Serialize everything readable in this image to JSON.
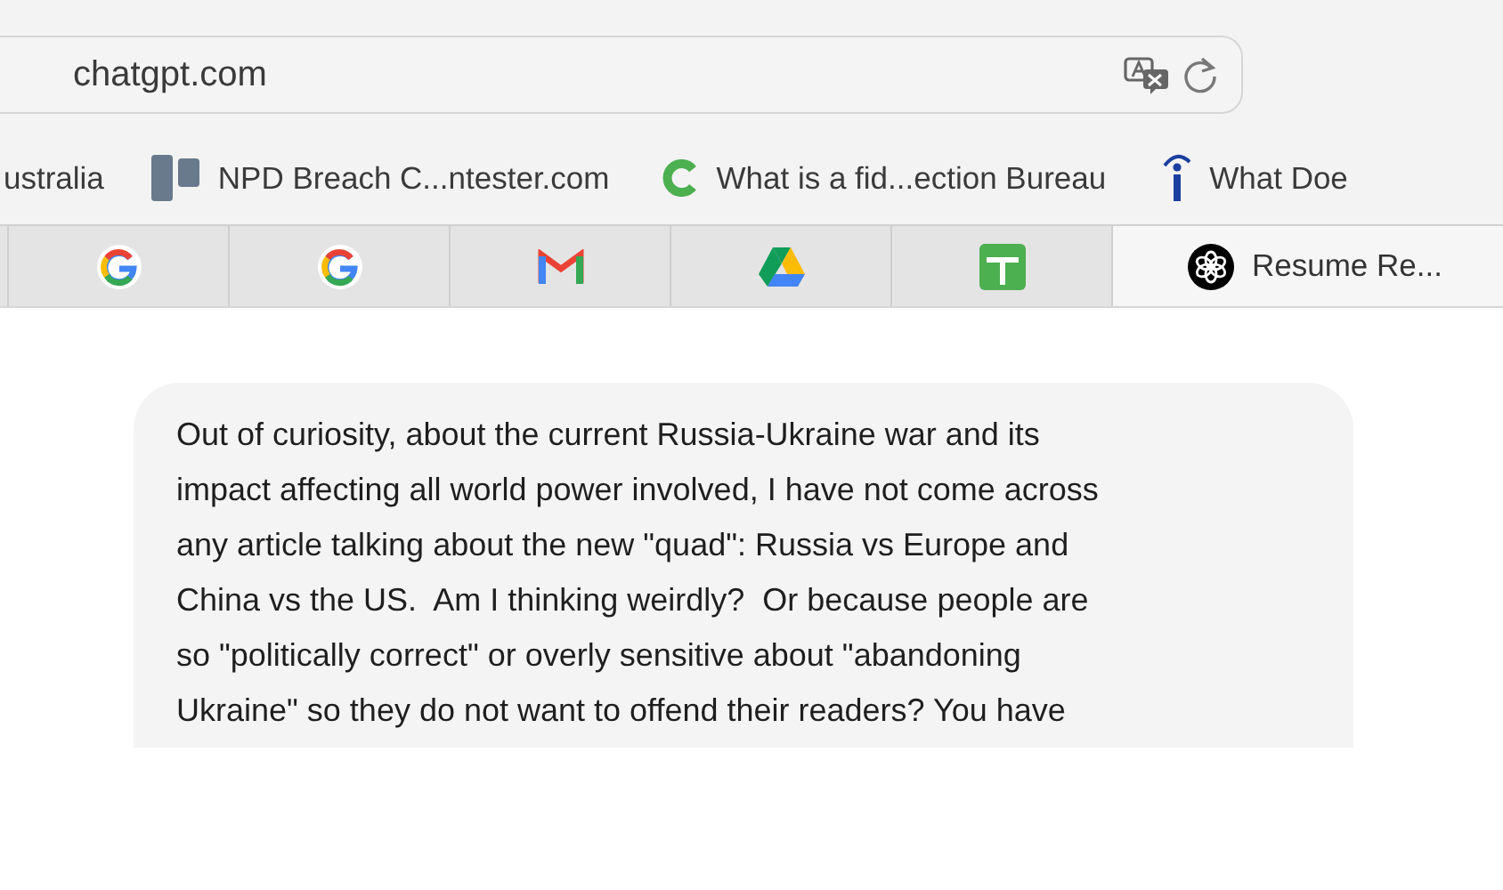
{
  "address_bar": {
    "url": "chatgpt.com"
  },
  "bookmarks": [
    {
      "label": "ustralia"
    },
    {
      "label": "NPD Breach C...ntester.com"
    },
    {
      "label": "What is a fid...ection Bureau"
    },
    {
      "label": "What Doe"
    }
  ],
  "tabs": [
    {
      "selected": false
    },
    {
      "selected": false
    },
    {
      "selected": false
    },
    {
      "selected": false
    },
    {
      "selected": false
    },
    {
      "selected": false
    },
    {
      "label": "Resume Re...",
      "selected": true
    }
  ],
  "message": {
    "lines": [
      "Out of curiosity, about the current Russia-Ukraine war and its",
      "impact affecting all world power involved, I have not come across",
      "any article talking about the new \"quad\": Russia vs Europe and",
      "China vs the US.  Am I thinking weirdly?  Or because people are",
      "so \"politically correct\" or overly sensitive about \"abandoning",
      "Ukraine\" so they do not want to offend their readers? You have"
    ]
  }
}
